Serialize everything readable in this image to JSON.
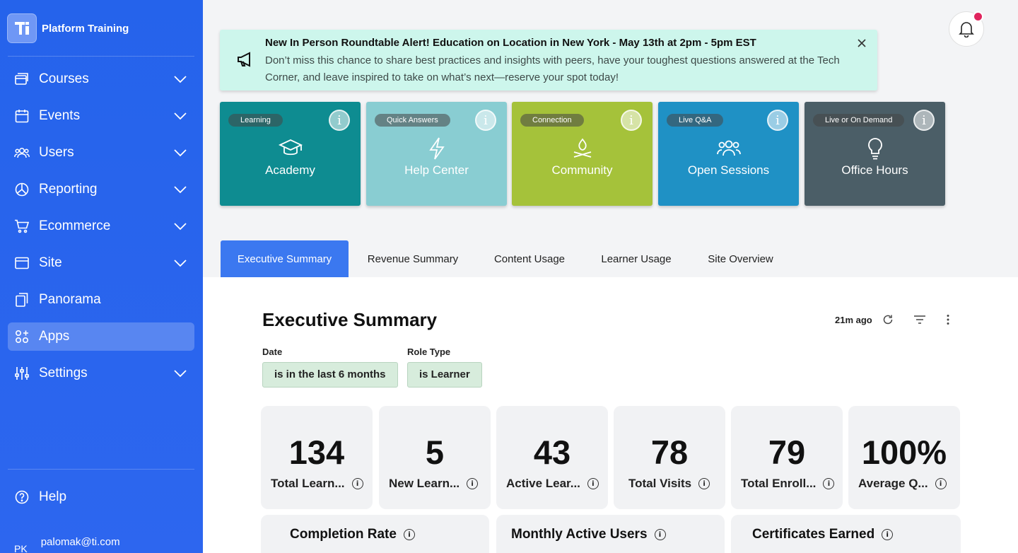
{
  "sidebar": {
    "brand": "Platform Training",
    "items": [
      {
        "label": "Courses",
        "icon": "courses-icon",
        "chevron": true
      },
      {
        "label": "Events",
        "icon": "calendar-icon",
        "chevron": true
      },
      {
        "label": "Users",
        "icon": "users-icon",
        "chevron": true
      },
      {
        "label": "Reporting",
        "icon": "pie-chart-icon",
        "chevron": true
      },
      {
        "label": "Ecommerce",
        "icon": "cart-icon",
        "chevron": true
      },
      {
        "label": "Site",
        "icon": "browser-icon",
        "chevron": true
      },
      {
        "label": "Panorama",
        "icon": "copy-icon",
        "chevron": false
      },
      {
        "label": "Apps",
        "icon": "apps-icon",
        "chevron": false,
        "active": true
      },
      {
        "label": "Settings",
        "icon": "sliders-icon",
        "chevron": true
      }
    ],
    "help": "Help",
    "user_initials": "PK",
    "user_email": "palomak@ti.com"
  },
  "banner": {
    "title": "New In Person Roundtable Alert! Education on Location in New York - May 13th at 2pm - 5pm EST",
    "text": "Don’t miss this chance to share best practices and insights with peers, have your toughest questions answered at the Tech Corner, and leave inspired to take on what’s next—reserve your spot today!"
  },
  "cards": [
    {
      "badge": "Learning",
      "label": "Academy",
      "color": "#0e8c91"
    },
    {
      "badge": "Quick Answers",
      "label": "Help Center",
      "color": "#89cdd2"
    },
    {
      "badge": "Connection",
      "label": "Community",
      "color": "#a5c23a"
    },
    {
      "badge": "Live Q&A",
      "label": "Open Sessions",
      "color": "#1f91c5"
    },
    {
      "badge": "Live or On Demand",
      "label": "Office Hours",
      "color": "#4b5e67"
    }
  ],
  "tabs": [
    "Executive Summary",
    "Revenue Summary",
    "Content Usage",
    "Learner Usage",
    "Site Overview"
  ],
  "dashboard": {
    "title": "Executive Summary",
    "updated": "21m ago",
    "filters": [
      {
        "label": "Date",
        "value": "is in the last 6 months"
      },
      {
        "label": "Role Type",
        "value": "is Learner"
      }
    ],
    "stats": [
      {
        "value": "134",
        "label": "Total Learn..."
      },
      {
        "value": "5",
        "label": "New Learn..."
      },
      {
        "value": "43",
        "label": "Active Lear..."
      },
      {
        "value": "78",
        "label": "Total Visits"
      },
      {
        "value": "79",
        "label": "Total Enroll..."
      },
      {
        "value": "100%",
        "label": "Average Q..."
      }
    ],
    "panels": [
      "Completion Rate",
      "Monthly Active Users",
      "Certificates Earned"
    ]
  },
  "colors": {
    "sidebar": "#2563eb",
    "active_tab": "#3b78f0",
    "banner": "#cdf6ec",
    "notification_dot": "#e0245e"
  }
}
